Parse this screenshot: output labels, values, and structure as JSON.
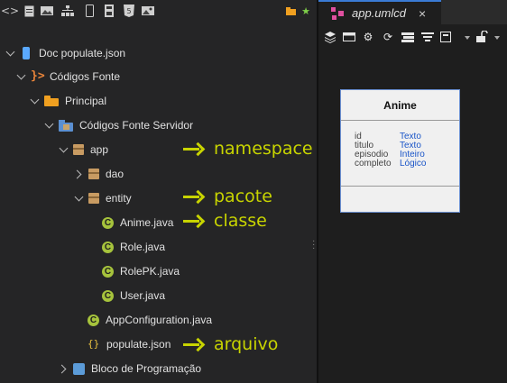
{
  "toolbar": {
    "icons": [
      "code-brackets-icon",
      "document-icon",
      "image-icon",
      "tree-icon",
      "device-icon",
      "save-icon",
      "html5-icon",
      "picture-icon"
    ],
    "right_icons": [
      "folder-icon",
      "star-icon"
    ]
  },
  "tree": {
    "root": {
      "label": "Doc populate.json"
    },
    "source": {
      "label": "Códigos Fonte"
    },
    "principal": {
      "label": "Principal"
    },
    "server": {
      "label": "Códigos Fonte Servidor"
    },
    "app": {
      "label": "app"
    },
    "dao": {
      "label": "dao"
    },
    "entity": {
      "label": "entity"
    },
    "files": [
      {
        "label": "Anime.java"
      },
      {
        "label": "Role.java"
      },
      {
        "label": "RolePK.java"
      },
      {
        "label": "User.java"
      }
    ],
    "appconfig": {
      "label": "AppConfiguration.java"
    },
    "populate": {
      "label": "populate.json"
    },
    "bloco": {
      "label": "Bloco de Programação"
    }
  },
  "annotations": {
    "namespace": "namespace",
    "pacote": "pacote",
    "classe": "classe",
    "arquivo": "arquivo"
  },
  "editor": {
    "tab_title": "app.umlcd",
    "close_glyph": "×"
  },
  "uml": {
    "class_name": "Anime",
    "attributes": [
      {
        "name": "id",
        "type": "Texto"
      },
      {
        "name": "titulo",
        "type": "Texto"
      },
      {
        "name": "episodio",
        "type": "Inteiro"
      },
      {
        "name": "completo",
        "type": "Lógico"
      }
    ]
  },
  "colors": {
    "annotation": "#c8d400",
    "accent": "#3a7bd5",
    "attr_type": "#1a55c8"
  }
}
